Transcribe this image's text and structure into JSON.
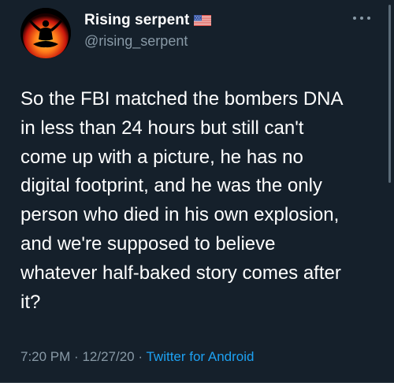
{
  "user": {
    "display_name": "Rising serpent",
    "handle": "@rising_serpent",
    "flag_icon": "us-flag-icon"
  },
  "tweet": {
    "text": "So the FBI matched the bombers DNA\nin less than 24 hours but still can't\ncome up with a picture, he has no\ndigital footprint, and he was the only\nperson who died in his own explosion,\nand we're supposed to believe\nwhatever half-baked story comes after\nit?",
    "time": "7:20 PM",
    "separator": "·",
    "date": "12/27/20",
    "source": "Twitter for Android"
  },
  "colors": {
    "background": "#15202b",
    "secondary_text": "#8899a6",
    "link": "#1da1f2"
  }
}
